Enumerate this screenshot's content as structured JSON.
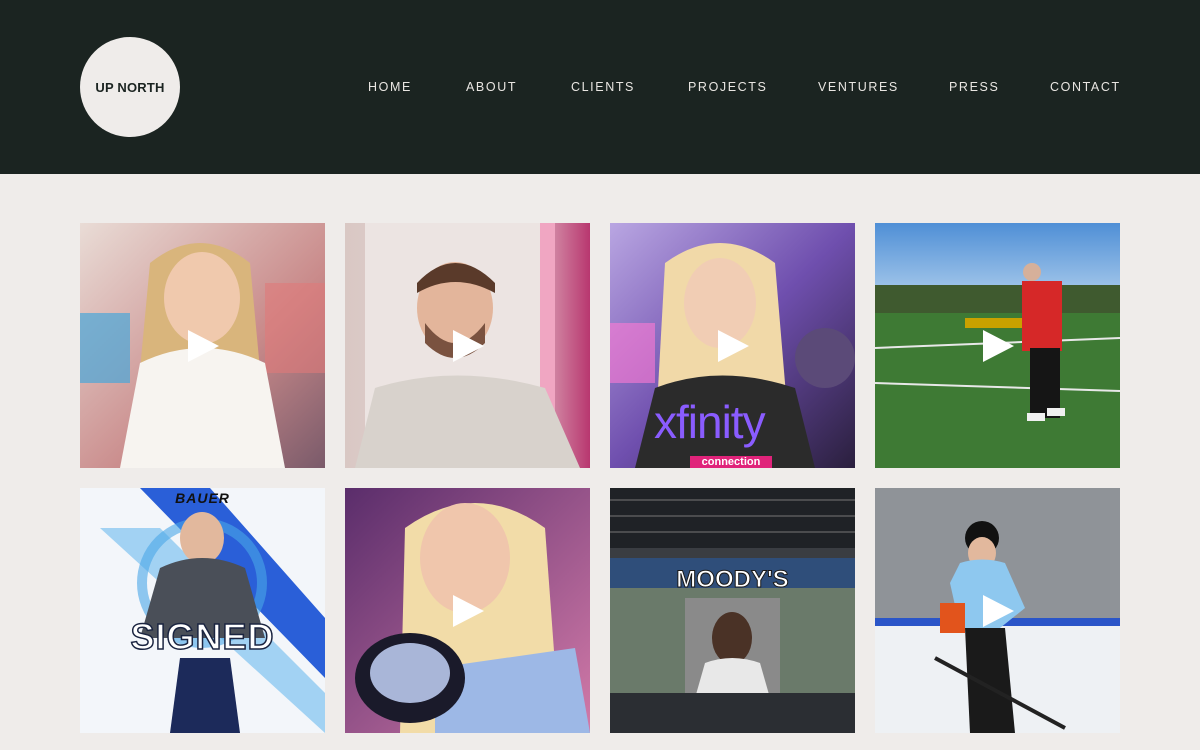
{
  "header": {
    "logo_text": "UP NORTH",
    "nav": [
      {
        "label": "HOME"
      },
      {
        "label": "ABOUT"
      },
      {
        "label": "CLIENTS"
      },
      {
        "label": "PROJECTS"
      },
      {
        "label": "VENTURES"
      },
      {
        "label": "PRESS"
      },
      {
        "label": "CONTACT"
      }
    ]
  },
  "tiles": [
    {
      "overlay": ""
    },
    {
      "overlay": ""
    },
    {
      "overlay": "xfinity",
      "sub": "connection"
    },
    {
      "overlay": ""
    },
    {
      "overlay": "SIGNED",
      "brand": "BAUER"
    },
    {
      "overlay": ""
    },
    {
      "overlay": "MOODY'S"
    },
    {
      "overlay": ""
    }
  ],
  "colors": {
    "header_bg": "#1b2421",
    "page_bg": "#efecea",
    "nav_text": "#e9e6e2"
  }
}
